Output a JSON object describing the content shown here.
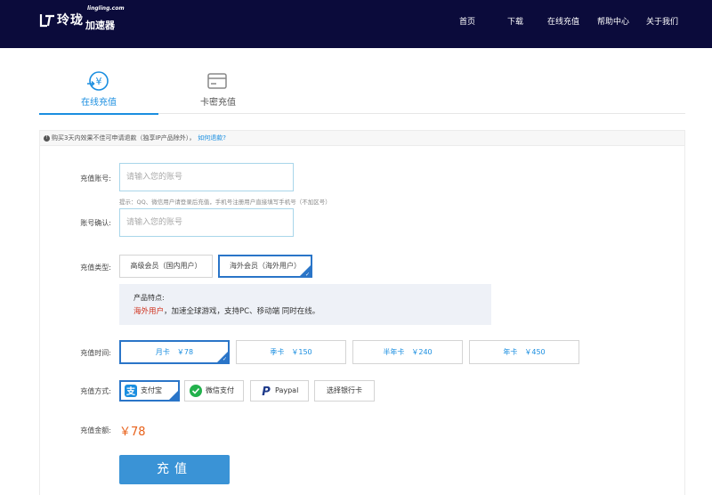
{
  "header": {
    "brand": "玲珑",
    "brand_sub": "加速器",
    "brand_domain": "lingling.com",
    "nav": [
      {
        "label": "首页"
      },
      {
        "label": "下载"
      },
      {
        "label": "在线充值"
      },
      {
        "label": "帮助中心"
      },
      {
        "label": "关于我们"
      }
    ]
  },
  "tabs": [
    {
      "label": "在线充值",
      "icon": "online-recharge-icon",
      "active": true
    },
    {
      "label": "卡密充值",
      "icon": "card-icon",
      "active": false
    }
  ],
  "notice": {
    "text": "购买3天内效果不佳可申请退款（独享IP产品除外），",
    "link": "如何退款?"
  },
  "form": {
    "account_label": "充值账号:",
    "account_placeholder": "请输入您的账号",
    "account_hint": "提示：QQ、微信用户请登录后充值，手机号注册用户直接填写手机号（不加区号）",
    "confirm_label": "账号确认:",
    "confirm_placeholder": "请输入您的账号",
    "type_label": "充值类型:",
    "types": [
      {
        "label": "高级会员（国内用户）",
        "selected": false
      },
      {
        "label": "海外会员（海外用户）",
        "selected": true
      }
    ],
    "features_title": "产品特点:",
    "features_highlight": "海外用户",
    "features_text": "，加速全球游戏，支持PC、移动端 同时在线。",
    "time_label": "充值时间:",
    "durations": [
      {
        "name": "月卡",
        "price": "￥78",
        "selected": true
      },
      {
        "name": "季卡",
        "price": "￥150",
        "selected": false
      },
      {
        "name": "半年卡",
        "price": "￥240",
        "selected": false
      },
      {
        "name": "年卡",
        "price": "￥450",
        "selected": false
      }
    ],
    "payment_label": "充值方式:",
    "payments": [
      {
        "label": "支付宝",
        "icon": "alipay-icon",
        "selected": true
      },
      {
        "label": "微信支付",
        "icon": "wechat-pay-icon",
        "selected": false
      },
      {
        "label": "Paypal",
        "icon": "paypal-icon",
        "selected": false
      },
      {
        "label": "选择银行卡",
        "icon": "",
        "selected": false
      }
    ],
    "amount_label": "充值金额:",
    "amount": "￥78",
    "submit_label": "充值"
  },
  "colors": {
    "header_bg": "#0b0b3b",
    "accent": "#1a8ee0",
    "selected_border": "#2a75c8",
    "price_orange": "#e8611a",
    "highlight_red": "#d0321e",
    "submit_bg": "#3a93d6"
  }
}
